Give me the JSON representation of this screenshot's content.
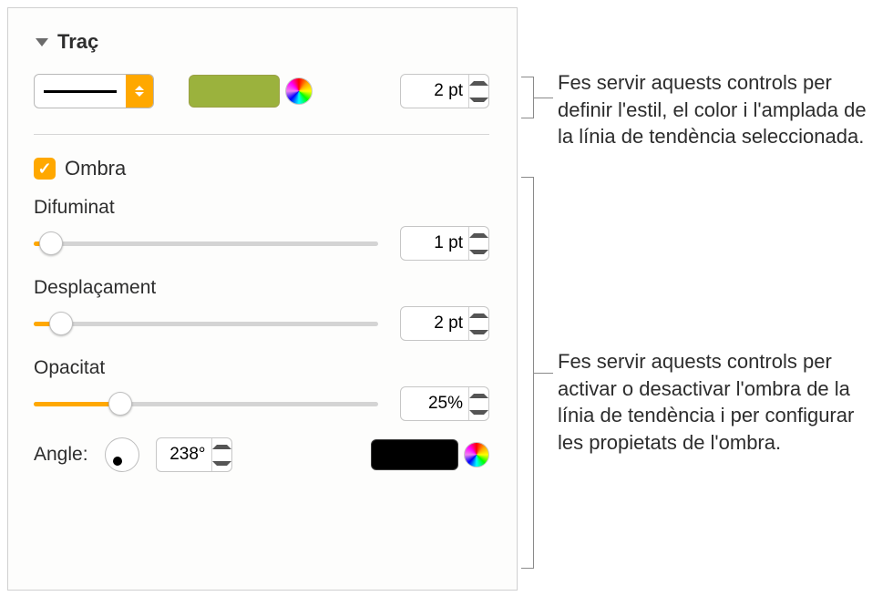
{
  "stroke": {
    "title": "Traç",
    "swatchColor": "#9bb23d",
    "width": "2 pt"
  },
  "shadow": {
    "title": "Ombra",
    "checked": true,
    "difuminat": {
      "label": "Difuminat",
      "value": "1 pt",
      "percent": 5
    },
    "desplacament": {
      "label": "Desplaçament",
      "value": "2 pt",
      "percent": 8
    },
    "opacitat": {
      "label": "Opacitat",
      "value": "25%",
      "percent": 25
    },
    "angle": {
      "label": "Angle:",
      "value": "238°"
    },
    "color": "#000000"
  },
  "callouts": {
    "c1": "Fes servir aquests controls per definir l'estil, el color i l'amplada de la línia de tendència seleccionada.",
    "c2": "Fes servir aquests controls per activar o desactivar l'ombra de la línia de tendència i per configurar les propietats de l'ombra."
  }
}
